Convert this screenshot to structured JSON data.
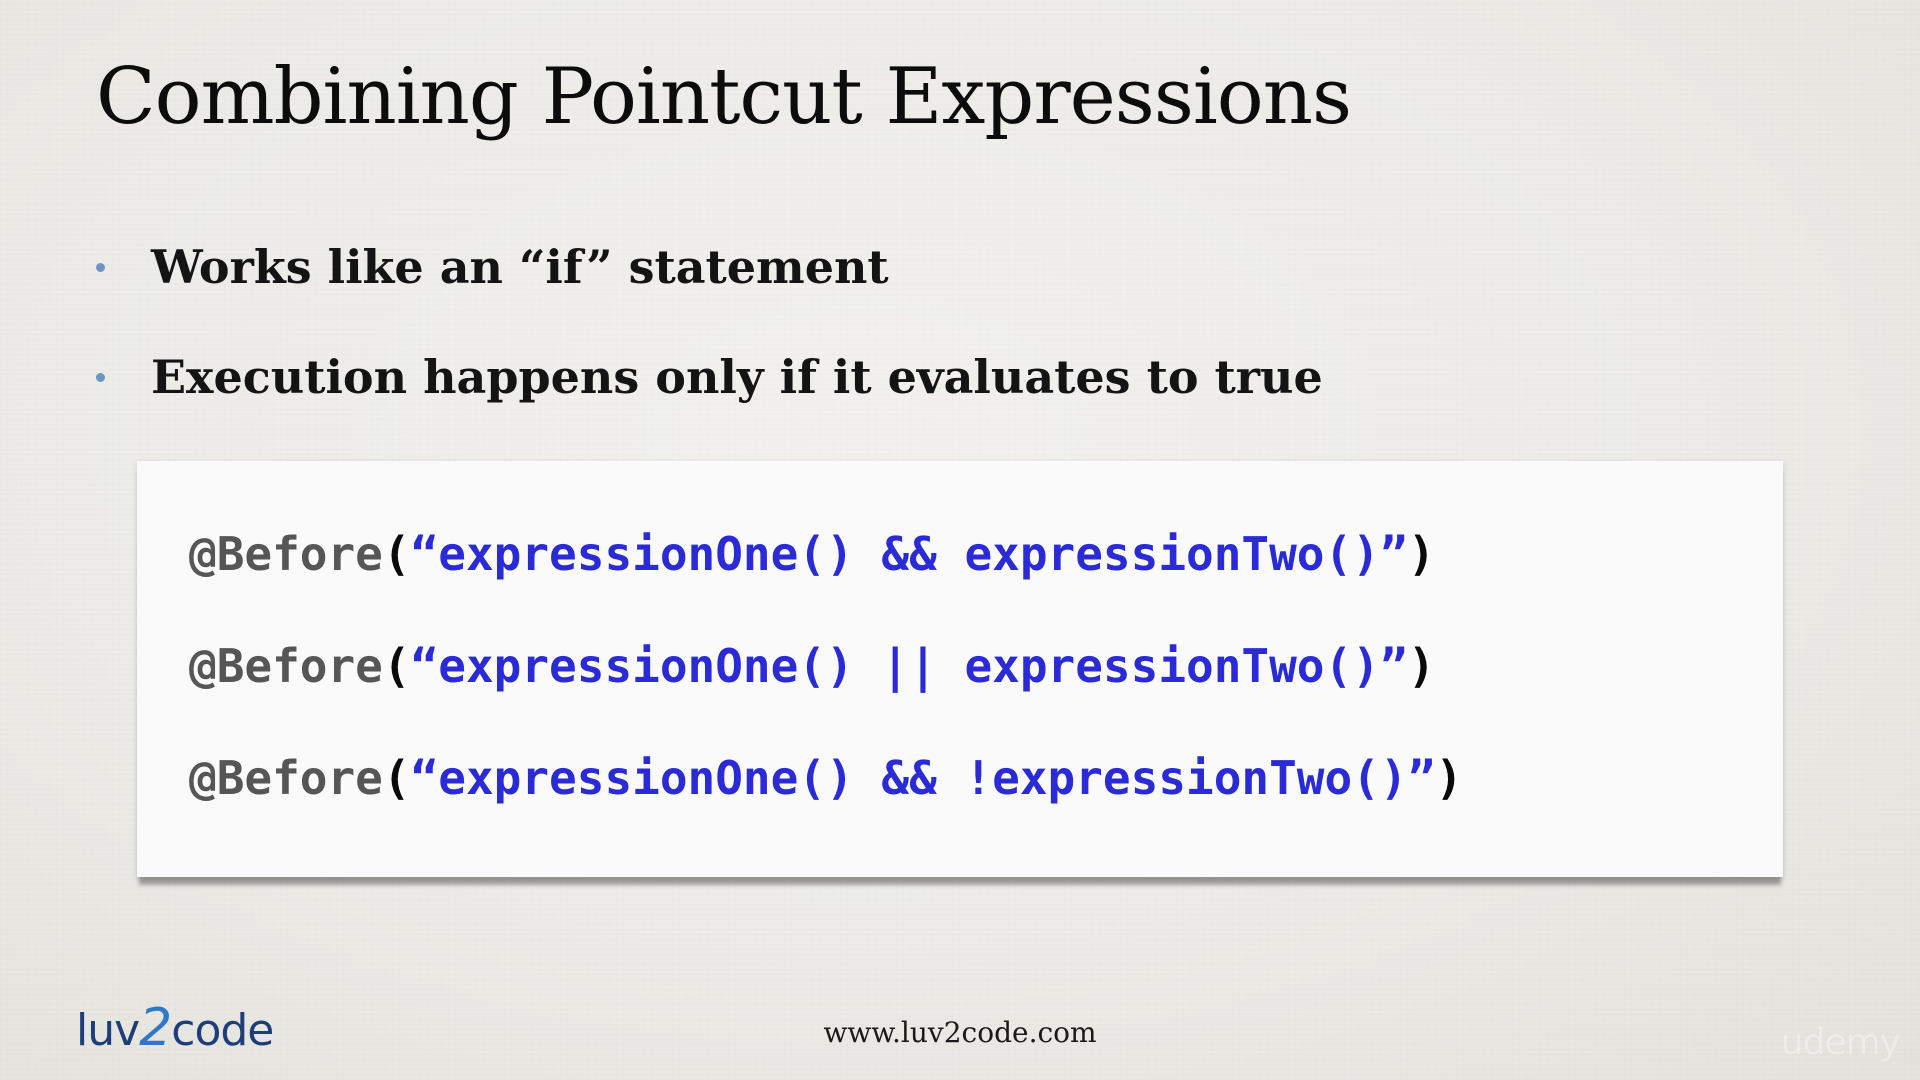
{
  "slide": {
    "title": "Combining Pointcut Expressions",
    "bullets": [
      "Works like an “if” statement",
      "Execution happens only if it evaluates to true"
    ],
    "code_lines": [
      {
        "annotation": "@Before",
        "open": "(",
        "string": "“expressionOne() && expressionTwo()”",
        "close": ")"
      },
      {
        "annotation": "@Before",
        "open": "(",
        "string": "“expressionOne() || expressionTwo()”",
        "close": ")"
      },
      {
        "annotation": "@Before",
        "open": "(",
        "string": "“expressionOne() && !expressionTwo()”",
        "close": ")"
      }
    ]
  },
  "footer": {
    "logo_left": "luv",
    "logo_two": "2",
    "logo_right": "code",
    "url": "www.luv2code.com",
    "watermark": "udemy"
  },
  "colors": {
    "bullet_dot": "#6e94c0",
    "code_string": "#2a2ad6",
    "code_annotation": "#565656",
    "logo": "#1d3e78"
  }
}
